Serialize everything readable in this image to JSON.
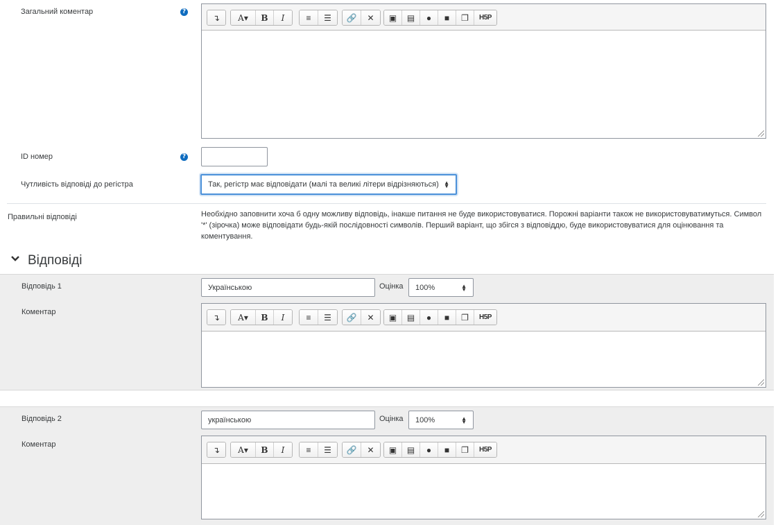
{
  "general_feedback": {
    "label": "Загальний коментар",
    "help_icon": "question-circle-icon"
  },
  "id_number": {
    "label": "ID номер",
    "value": ""
  },
  "case_sensitivity": {
    "label": "Чутливість відповіді до регістра",
    "selected": "Так, регістр має відповідати (малі та великі літери відрізняються)"
  },
  "correct_answers": {
    "label": "Правильні відповіді",
    "text": "Необхідно заповнити хоча б одну можливу відповідь, інакше питання не буде використовуватися. Порожні варіанти також не використовуватимуться. Символ '*' (зірочка) може відповідати будь-якій послідовності символів. Перший варіант, що збігся з відповіддю, буде використовуватися для оцінювання та коментування."
  },
  "answers_section": {
    "title": "Відповіді",
    "chevron": "chevron-down-icon"
  },
  "answer1": {
    "label": "Відповідь 1",
    "value": "Українською",
    "grade_label": "Оцінка",
    "grade": "100%",
    "comment_label": "Коментар"
  },
  "answer2": {
    "label": "Відповідь 2",
    "value": "українською",
    "grade_label": "Оцінка",
    "grade": "100%",
    "comment_label": "Коментар"
  },
  "toolbar": {
    "font_btn": "A",
    "bold": "B",
    "italic": "I",
    "h5p": "H5P",
    "icons": [
      "collapse-icon",
      "font-style-icon",
      "bold-icon",
      "italic-icon",
      "unordered-list-icon",
      "ordered-list-icon",
      "link-icon",
      "unlink-icon",
      "image-icon",
      "media-icon",
      "record-audio-icon",
      "record-video-icon",
      "manage-files-icon",
      "h5p-icon"
    ]
  },
  "colors": {
    "accent": "#0f6cbf",
    "focus_border": "#4a90d9",
    "section_bg": "#eeeeee"
  }
}
